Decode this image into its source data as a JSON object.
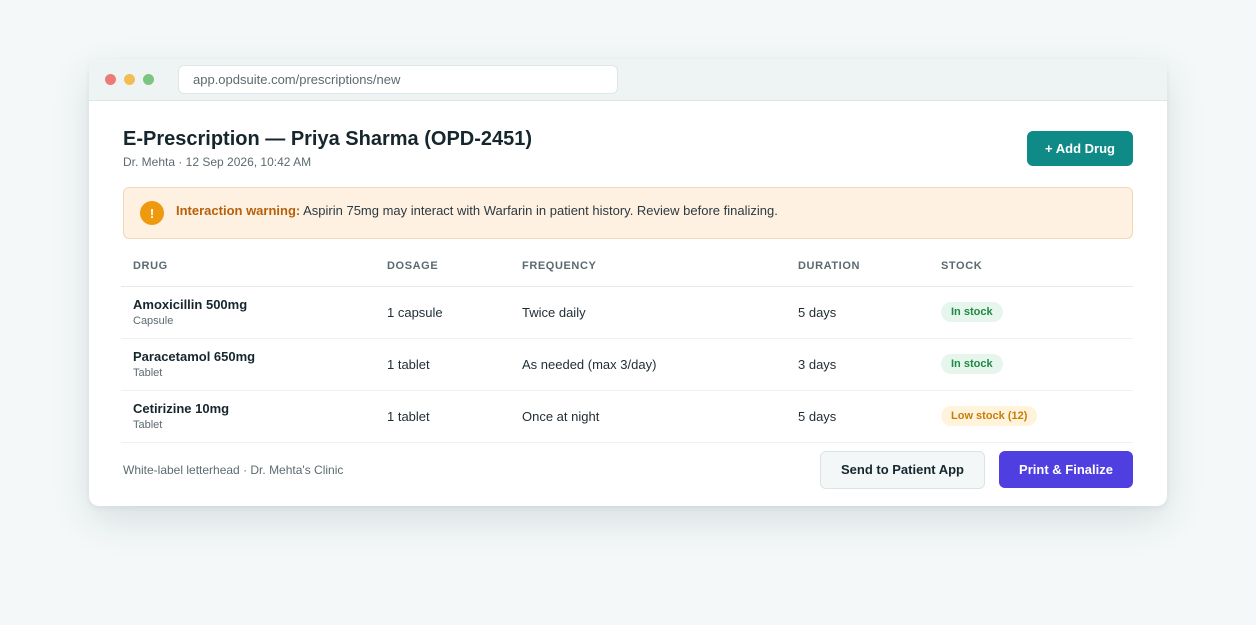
{
  "browser": {
    "url": "app.opdsuite.com/prescriptions/new"
  },
  "header": {
    "title": "E-Prescription — Priya Sharma (OPD-2451)",
    "subtitle": "Dr. Mehta · 12 Sep 2026, 10:42 AM",
    "add_button": "+ Add Drug"
  },
  "warning": {
    "icon_glyph": "!",
    "label": "Interaction warning:",
    "message": " Aspirin 75mg may interact with Warfarin in patient history. Review before finalizing."
  },
  "table": {
    "columns": [
      "DRUG",
      "DOSAGE",
      "FREQUENCY",
      "DURATION",
      "STOCK"
    ],
    "rows": [
      {
        "drug": "Amoxicillin 500mg",
        "form": "Capsule",
        "dosage": "1 capsule",
        "frequency": "Twice daily",
        "duration": "5 days",
        "stock": "In stock",
        "stock_status": "ok"
      },
      {
        "drug": "Paracetamol 650mg",
        "form": "Tablet",
        "dosage": "1 tablet",
        "frequency": "As needed (max 3/day)",
        "duration": "3 days",
        "stock": "In stock",
        "stock_status": "ok"
      },
      {
        "drug": "Cetirizine 10mg",
        "form": "Tablet",
        "dosage": "1 tablet",
        "frequency": "Once at night",
        "duration": "5 days",
        "stock": "Low stock (12)",
        "stock_status": "low"
      }
    ]
  },
  "footer": {
    "note": "White-label letterhead · Dr. Mehta's Clinic",
    "send_button": "Send to Patient App",
    "print_button": "Print & Finalize"
  },
  "colors": {
    "primary_teal": "#0f8a87",
    "primary_purple": "#4f3fe0",
    "warning_orange": "#ef9a0e",
    "stock_ok": "#1f8a45",
    "stock_low": "#c77d0a"
  }
}
